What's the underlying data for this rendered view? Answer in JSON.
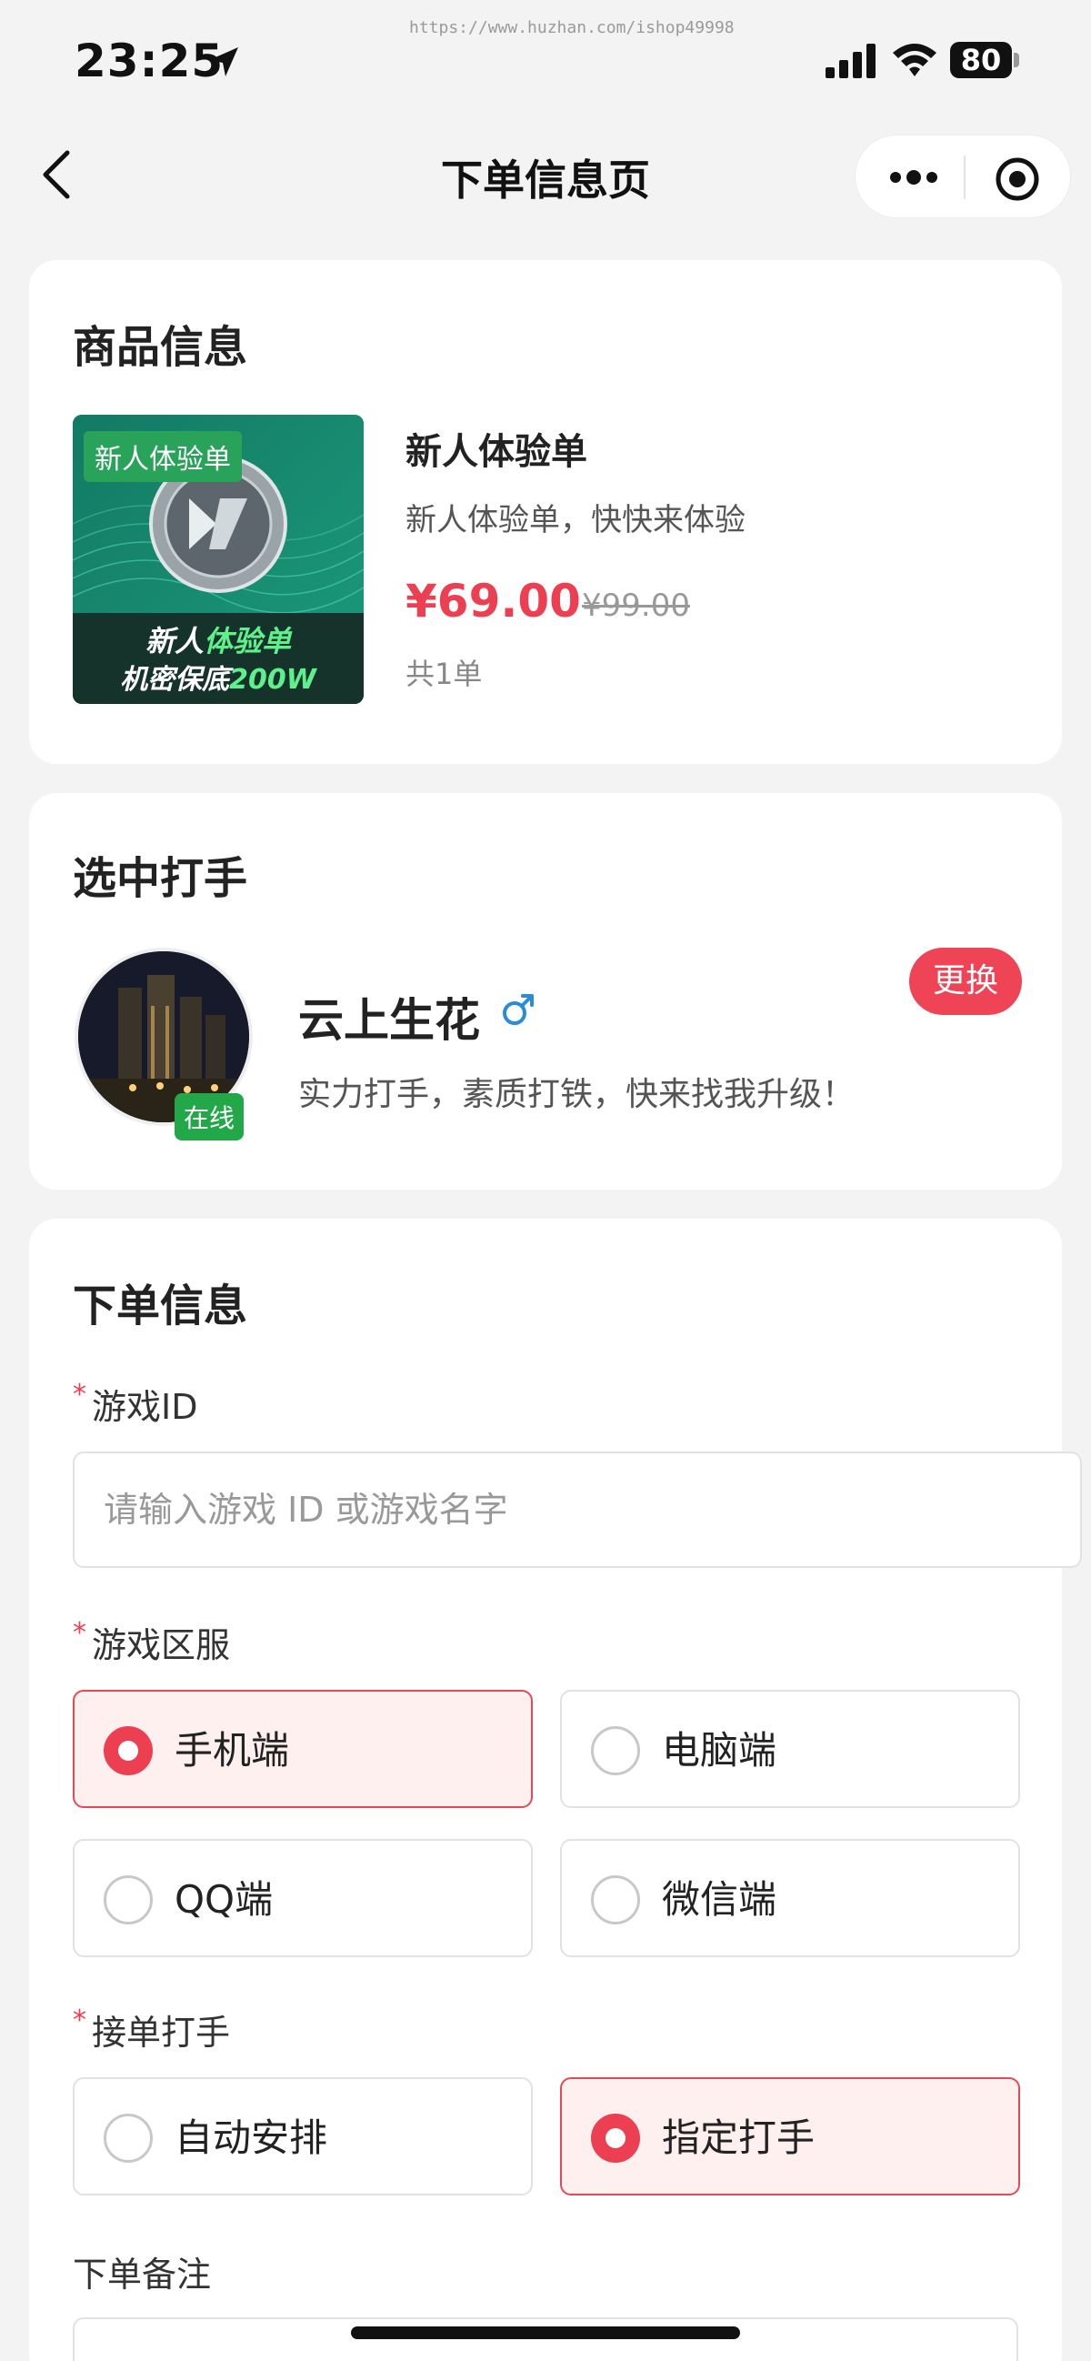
{
  "status_bar": {
    "time": "23:25",
    "watermark": "https://www.huzhan.com/ishop49998",
    "battery": "80"
  },
  "nav": {
    "title": "下单信息页"
  },
  "product": {
    "section_title": "商品信息",
    "image_tag": "新人体验单",
    "image_line1_a": "新人",
    "image_line1_b": "体验单",
    "image_line2_a": "机密保底",
    "image_line2_b": "200W",
    "name": "新人体验单",
    "description": "新人体验单，快快来体验",
    "price": "¥69.00",
    "original_price": "¥99.00",
    "count": "共1单"
  },
  "player": {
    "section_title": "选中打手",
    "online_badge": "在线",
    "name": "云上生花",
    "description": "实力打手，素质打铁，快来找我升级！",
    "change_label": "更换"
  },
  "order": {
    "section_title": "下单信息",
    "required_mark": "*",
    "game_id": {
      "label": "游戏ID",
      "placeholder": "请输入游戏 ID 或游戏名字",
      "value": ""
    },
    "server": {
      "label": "游戏区服",
      "options": [
        {
          "label": "手机端",
          "selected": true
        },
        {
          "label": "电脑端",
          "selected": false
        },
        {
          "label": "QQ端",
          "selected": false
        },
        {
          "label": "微信端",
          "selected": false
        }
      ]
    },
    "assign": {
      "label": "接单打手",
      "options": [
        {
          "label": "自动安排",
          "selected": false
        },
        {
          "label": "指定打手",
          "selected": true
        }
      ]
    },
    "remark": {
      "label": "下单备注"
    }
  },
  "colors": {
    "accent": "#ec3f52",
    "online": "#22a848",
    "background": "#f3f3f3"
  }
}
